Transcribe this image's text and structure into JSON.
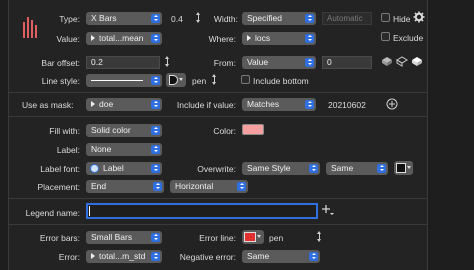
{
  "colors": {
    "accent": "#2f6fe0",
    "color_swatch": "#f4a0a0",
    "error_swatch": "#e03030"
  },
  "type_row": {
    "label": "Type:",
    "value": "X Bars",
    "number": "0.4",
    "width_label": "Width:",
    "width_value": "Specified",
    "auto_placeholder": "Automatic",
    "hide_label": "Hide"
  },
  "value_row": {
    "label": "Value:",
    "value": "total...mean",
    "where_label": "Where:",
    "where_value": "locs",
    "exclude_label": "Exclude"
  },
  "offset_row": {
    "label": "Bar offset:",
    "value": "0.2",
    "from_label": "From:",
    "from_value": "Value",
    "from_number": "0"
  },
  "line_row": {
    "label": "Line style:",
    "pen_value": "pen",
    "include_bottom_label": "Include bottom"
  },
  "mask_row": {
    "label": "Use as mask:",
    "value": "doe",
    "include_if_label": "Include if value:",
    "include_if_value": "Matches",
    "match_text": "20210602"
  },
  "fill_row": {
    "label": "Fill with:",
    "value": "Solid color",
    "color_label": "Color:"
  },
  "label_row": {
    "label": "Label:",
    "value": "None"
  },
  "font_row": {
    "label": "Label font:",
    "value": "Label",
    "overwrite_label": "Overwrite:",
    "overwrite_value": "Same Style",
    "same_value": "Same"
  },
  "placement_row": {
    "label": "Placement:",
    "value": "End",
    "orientation_value": "Horizontal"
  },
  "legend_row": {
    "label": "Legend name:",
    "value": ""
  },
  "errorbar_row": {
    "label": "Error bars:",
    "value": "Small Bars",
    "error_line_label": "Error line:",
    "pen_value": "pen"
  },
  "error_row": {
    "label": "Error:",
    "value": "total...m_std",
    "negative_label": "Negative error:",
    "negative_value": "Same"
  }
}
